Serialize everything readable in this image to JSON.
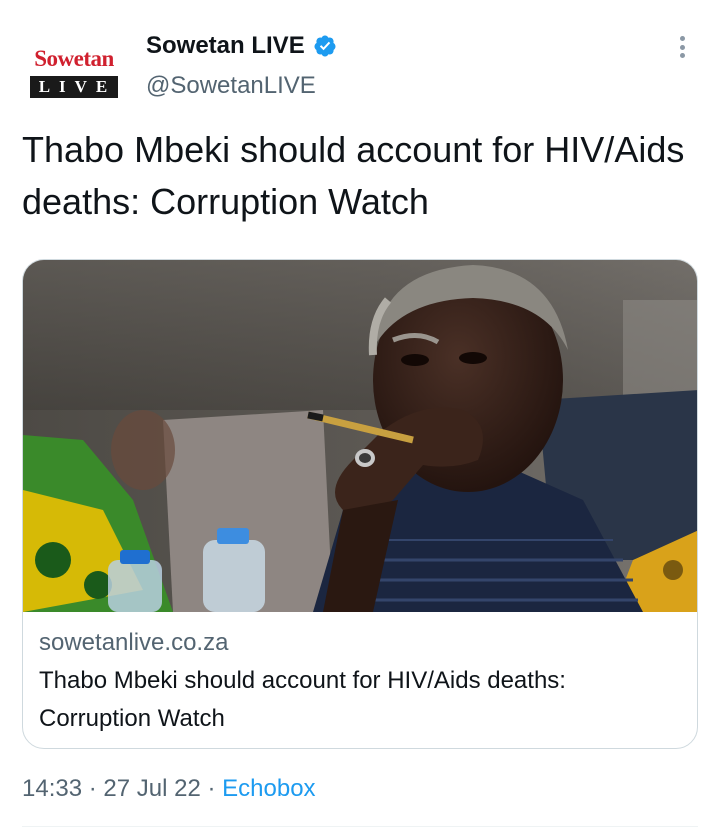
{
  "account": {
    "logo_top": "Sowetan",
    "logo_bottom": "LIVE",
    "display_name": "Sowetan LIVE",
    "handle": "@SowetanLIVE",
    "verified": true,
    "verified_color": "#1d9bf0"
  },
  "tweet": {
    "text": "Thabo Mbeki should account for HIV/Aids deaths: Corruption Watch"
  },
  "card": {
    "image_icon": "news-photo-man-with-pen",
    "domain": "sowetanlive.co.za",
    "title": "Thabo Mbeki should account for HIV/Aids deaths: Corruption Watch"
  },
  "meta": {
    "time": "14:33",
    "separator": "·",
    "date": "27 Jul 22",
    "source": "Echobox",
    "link_color": "#1d9bf0"
  },
  "icons": {
    "more": "more-options-icon",
    "verified": "verified-badge-icon"
  }
}
